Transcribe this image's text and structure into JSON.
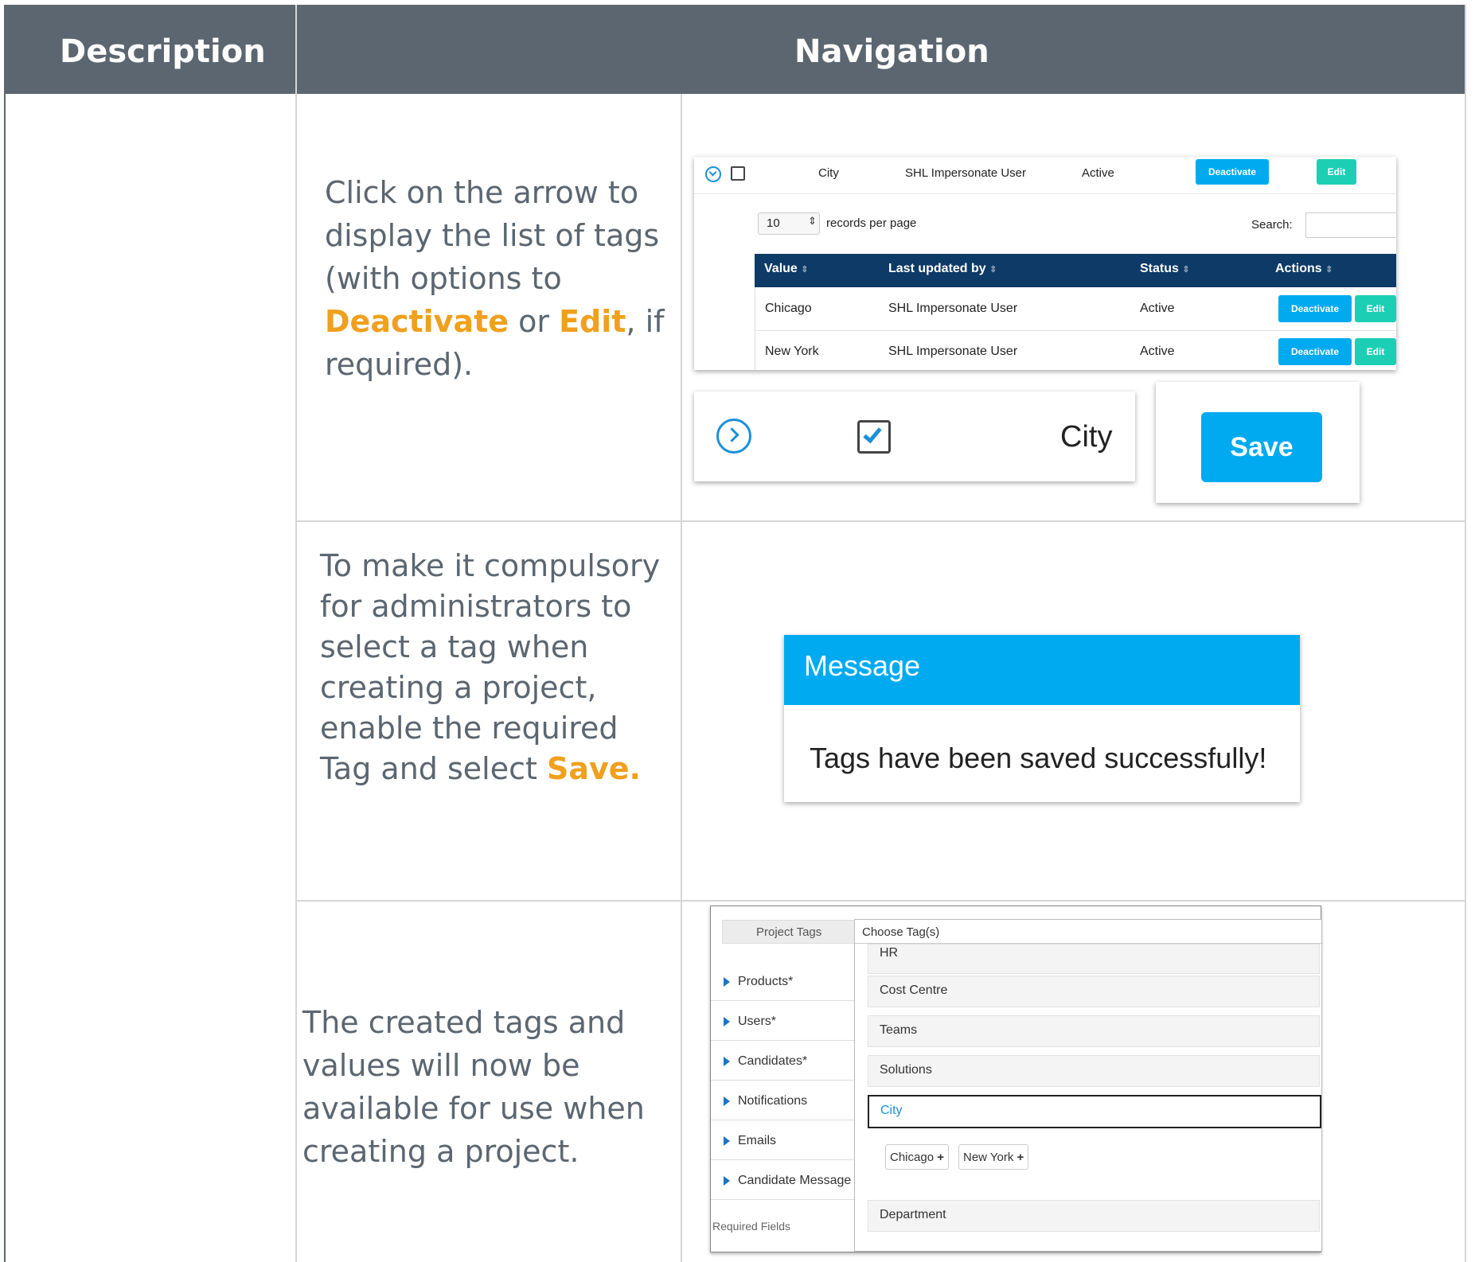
{
  "header": {
    "description": "Description",
    "navigation": "Navigation"
  },
  "rows": [
    {
      "text_parts": [
        "Click on the arrow to display the list of tags (with options to ",
        "Deactivate",
        " or ",
        "Edit",
        ", if required)."
      ]
    },
    {
      "text_parts": [
        "To make it compulsory for administrators to select a tag when creating a project, enable the required Tag and select ",
        "Save."
      ]
    },
    {
      "text": "The created tags  and values  will now be available for use when creating a project."
    }
  ],
  "screenshot1": {
    "top_row": {
      "name": "City",
      "updated_by": "SHL Impersonate User",
      "status": "Active",
      "deactivate": "Deactivate",
      "edit": "Edit"
    },
    "page_size": "10",
    "records_per_page": "records per page",
    "search_label": "Search:",
    "columns": [
      "Value",
      "Last updated by",
      "Status",
      "Actions"
    ],
    "sort_glyph": "⇕",
    "rows": [
      {
        "value": "Chicago",
        "updated_by": "SHL Impersonate User",
        "status": "Active",
        "deactivate": "Deactivate",
        "edit": "Edit"
      },
      {
        "value": "New York",
        "updated_by": "SHL Impersonate User",
        "status": "Active",
        "deactivate": "Deactivate",
        "edit": "Edit"
      }
    ],
    "zoom_label": "City",
    "save_label": "Save",
    "colors": {
      "primary": "#00aaf0",
      "teal": "#1ccfb4",
      "header": "#0d3a66"
    }
  },
  "screenshot2": {
    "title": "Message",
    "message": "Tags have been saved successfully!"
  },
  "screenshot3": {
    "project_tags_label": "Project Tags",
    "choose_placeholder": "Choose Tag(s)",
    "sidebar": [
      "Products*",
      "Users*",
      "Candidates*",
      "Notifications",
      "Emails",
      "Candidate Message"
    ],
    "required_fields": "Required Fields",
    "tags": [
      "HR",
      "Cost Centre",
      "Teams",
      "Solutions",
      "City",
      "Department"
    ],
    "values": [
      "Chicago",
      "New York"
    ]
  },
  "colors": {
    "header_bg": "#5b6670",
    "highlight": "#f0a01e",
    "text": "#5b6670"
  }
}
